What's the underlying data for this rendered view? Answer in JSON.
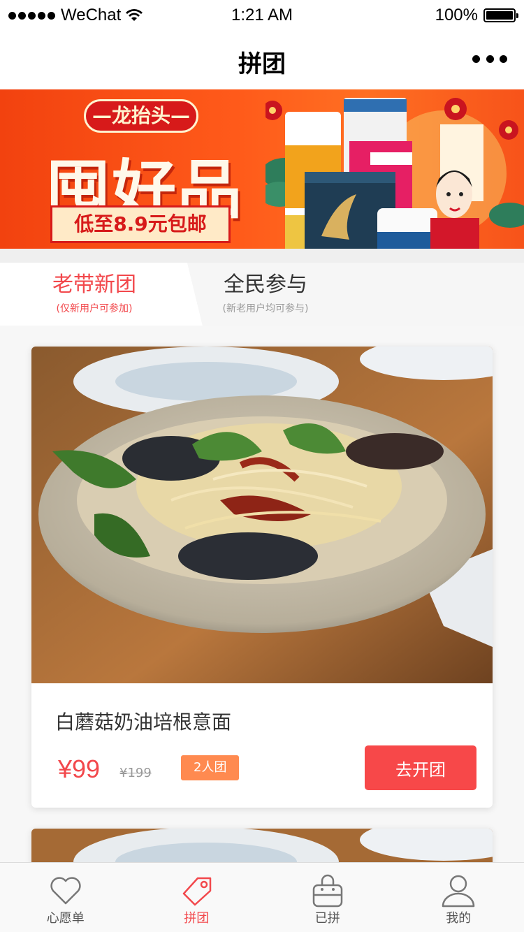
{
  "status_bar": {
    "carrier": "WeChat",
    "time": "1:21 AM",
    "battery": "100%",
    "battery_level": 1.0
  },
  "nav": {
    "title": "拼团",
    "more_icon": "more-dots-icon"
  },
  "banner": {
    "tag": "—龙抬头—",
    "headline": "囤好品",
    "subline": "低至8.9元包邮"
  },
  "tabs": [
    {
      "label": "老带新团",
      "note": "(仅新用户可参加)",
      "active": true
    },
    {
      "label": "全民参与",
      "note": "(新老用户均可参与)",
      "active": false
    }
  ],
  "products": [
    {
      "name": "白蘑菇奶油培根意面",
      "price": "¥99",
      "original_price": "¥199",
      "badge": "2人团",
      "button": "去开团"
    }
  ],
  "tabbar": [
    {
      "label": "心愿单",
      "icon": "heart-icon",
      "active": false
    },
    {
      "label": "拼团",
      "icon": "tag-icon",
      "active": true
    },
    {
      "label": "已拼",
      "icon": "bag-icon",
      "active": false
    },
    {
      "label": "我的",
      "icon": "user-icon",
      "active": false
    }
  ],
  "colors": {
    "accent": "#f2484c",
    "badge": "#ff8a50",
    "button": "#f74849",
    "banner": "#ff5a1a"
  }
}
